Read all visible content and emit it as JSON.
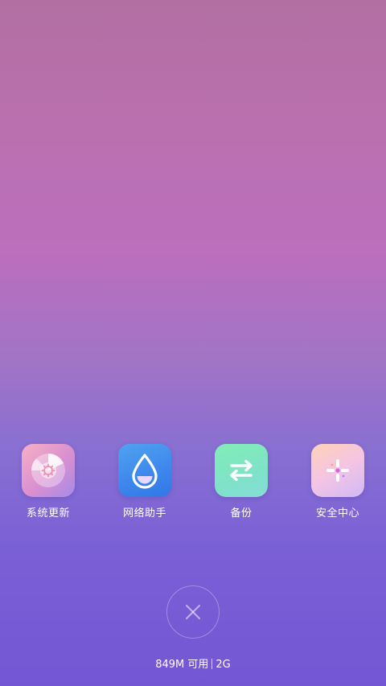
{
  "apps": [
    {
      "label": "系统更新",
      "icon": "system-update-icon"
    },
    {
      "label": "网络助手",
      "icon": "network-assistant-icon"
    },
    {
      "label": "备份",
      "icon": "backup-icon"
    },
    {
      "label": "安全中心",
      "icon": "security-center-icon"
    }
  ],
  "memory": {
    "available": "849M 可用",
    "total": "2G"
  },
  "colors": {
    "background_top": "#b270a2",
    "background_mid": "#bb6fbd",
    "background_bottom": "#7356d4",
    "text": "#ffffff"
  }
}
